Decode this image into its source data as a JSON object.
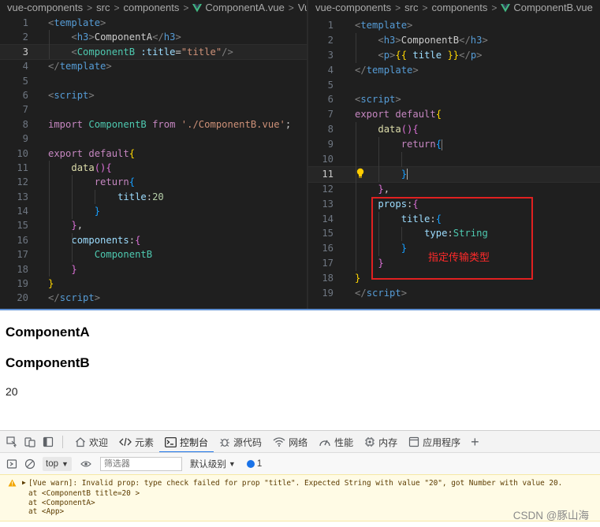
{
  "left_editor": {
    "breadcrumb": [
      "vue-components",
      "src",
      "components",
      "ComponentA.vue",
      "Vue"
    ],
    "current_line": 3,
    "lines": [
      {
        "n": "1",
        "tokens": [
          [
            "t-brk",
            "<"
          ],
          [
            "t-tag",
            "template"
          ],
          [
            "t-brk",
            ">"
          ]
        ]
      },
      {
        "n": "2",
        "tokens": [
          [
            "t-txt",
            "    "
          ],
          [
            "t-brk",
            "<"
          ],
          [
            "t-tag",
            "h3"
          ],
          [
            "t-brk",
            ">"
          ],
          [
            "t-txt",
            "ComponentA"
          ],
          [
            "t-brk",
            "</"
          ],
          [
            "t-tag",
            "h3"
          ],
          [
            "t-brk",
            ">"
          ]
        ]
      },
      {
        "n": "3",
        "tokens": [
          [
            "t-txt",
            "    "
          ],
          [
            "t-brk",
            "<"
          ],
          [
            "t-comp",
            "ComponentB"
          ],
          [
            "t-txt",
            " "
          ],
          [
            "t-attr",
            ":title"
          ],
          [
            "t-txt",
            "="
          ],
          [
            "t-str",
            "\"title\""
          ],
          [
            "t-brk",
            "/>"
          ]
        ]
      },
      {
        "n": "4",
        "tokens": [
          [
            "t-brk",
            "</"
          ],
          [
            "t-tag",
            "template"
          ],
          [
            "t-brk",
            ">"
          ]
        ]
      },
      {
        "n": "5",
        "tokens": []
      },
      {
        "n": "6",
        "tokens": [
          [
            "t-brk",
            "<"
          ],
          [
            "t-tag",
            "script"
          ],
          [
            "t-brk",
            ">"
          ]
        ]
      },
      {
        "n": "7",
        "tokens": []
      },
      {
        "n": "8",
        "tokens": [
          [
            "t-kw",
            "import"
          ],
          [
            "t-txt",
            " "
          ],
          [
            "t-comp",
            "ComponentB"
          ],
          [
            "t-txt",
            " "
          ],
          [
            "t-kw",
            "from"
          ],
          [
            "t-txt",
            " "
          ],
          [
            "t-str",
            "'./ComponentB.vue'"
          ],
          [
            "t-txt",
            ";"
          ]
        ]
      },
      {
        "n": "9",
        "tokens": []
      },
      {
        "n": "10",
        "tokens": [
          [
            "t-kw",
            "export"
          ],
          [
            "t-txt",
            " "
          ],
          [
            "t-kw",
            "default"
          ],
          [
            "b-y",
            "{"
          ]
        ]
      },
      {
        "n": "11",
        "tokens": [
          [
            "t-txt",
            "    "
          ],
          [
            "t-fn",
            "data"
          ],
          [
            "b-p",
            "()"
          ],
          [
            "b-p",
            "{"
          ]
        ]
      },
      {
        "n": "12",
        "tokens": [
          [
            "t-txt",
            "        "
          ],
          [
            "t-kw",
            "return"
          ],
          [
            "b-b",
            "{"
          ]
        ]
      },
      {
        "n": "13",
        "tokens": [
          [
            "t-txt",
            "            "
          ],
          [
            "t-var",
            "title"
          ],
          [
            "t-txt",
            ":"
          ],
          [
            "t-num",
            "20"
          ]
        ]
      },
      {
        "n": "14",
        "tokens": [
          [
            "t-txt",
            "        "
          ],
          [
            "b-b",
            "}"
          ]
        ]
      },
      {
        "n": "15",
        "tokens": [
          [
            "t-txt",
            "    "
          ],
          [
            "b-p",
            "}"
          ],
          [
            "t-txt",
            ","
          ]
        ]
      },
      {
        "n": "16",
        "tokens": [
          [
            "t-txt",
            "    "
          ],
          [
            "t-var",
            "components"
          ],
          [
            "t-txt",
            ":"
          ],
          [
            "b-p",
            "{"
          ]
        ]
      },
      {
        "n": "17",
        "tokens": [
          [
            "t-txt",
            "        "
          ],
          [
            "t-comp",
            "ComponentB"
          ]
        ]
      },
      {
        "n": "18",
        "tokens": [
          [
            "t-txt",
            "    "
          ],
          [
            "b-p",
            "}"
          ]
        ]
      },
      {
        "n": "19",
        "tokens": [
          [
            "b-y",
            "}"
          ]
        ]
      },
      {
        "n": "20",
        "tokens": [
          [
            "t-brk",
            "</"
          ],
          [
            "t-tag",
            "script"
          ],
          [
            "t-brk",
            ">"
          ]
        ]
      }
    ]
  },
  "right_editor": {
    "breadcrumb": [
      "vue-components",
      "src",
      "components",
      "ComponentB.vue"
    ],
    "current_line": 11,
    "lines": [
      {
        "n": "1",
        "tokens": [
          [
            "t-brk",
            "<"
          ],
          [
            "t-tag",
            "template"
          ],
          [
            "t-brk",
            ">"
          ]
        ]
      },
      {
        "n": "2",
        "tokens": [
          [
            "t-txt",
            "    "
          ],
          [
            "t-brk",
            "<"
          ],
          [
            "t-tag",
            "h3"
          ],
          [
            "t-brk",
            ">"
          ],
          [
            "t-txt",
            "ComponentB"
          ],
          [
            "t-brk",
            "</"
          ],
          [
            "t-tag",
            "h3"
          ],
          [
            "t-brk",
            ">"
          ]
        ]
      },
      {
        "n": "3",
        "tokens": [
          [
            "t-txt",
            "    "
          ],
          [
            "t-brk",
            "<"
          ],
          [
            "t-tag",
            "p"
          ],
          [
            "t-brk",
            ">"
          ],
          [
            "b-y",
            "{{"
          ],
          [
            "t-txt",
            " "
          ],
          [
            "t-var",
            "title"
          ],
          [
            "t-txt",
            " "
          ],
          [
            "b-y",
            "}}"
          ],
          [
            "t-brk",
            "</"
          ],
          [
            "t-tag",
            "p"
          ],
          [
            "t-brk",
            ">"
          ]
        ]
      },
      {
        "n": "4",
        "tokens": [
          [
            "t-brk",
            "</"
          ],
          [
            "t-tag",
            "template"
          ],
          [
            "t-brk",
            ">"
          ]
        ]
      },
      {
        "n": "5",
        "tokens": []
      },
      {
        "n": "6",
        "tokens": [
          [
            "t-brk",
            "<"
          ],
          [
            "t-tag",
            "script"
          ],
          [
            "t-brk",
            ">"
          ]
        ]
      },
      {
        "n": "7",
        "tokens": [
          [
            "t-kw",
            "export"
          ],
          [
            "t-txt",
            " "
          ],
          [
            "t-kw",
            "default"
          ],
          [
            "b-y",
            "{"
          ]
        ]
      },
      {
        "n": "8",
        "tokens": [
          [
            "t-txt",
            "    "
          ],
          [
            "t-fn",
            "data"
          ],
          [
            "b-p",
            "()"
          ],
          [
            "b-p",
            "{"
          ]
        ]
      },
      {
        "n": "9",
        "tokens": [
          [
            "t-txt",
            "        "
          ],
          [
            "t-kw",
            "return"
          ],
          [
            "b-b",
            "{"
          ]
        ]
      },
      {
        "n": "10",
        "tokens": []
      },
      {
        "n": "11",
        "tokens": [
          [
            "t-txt",
            "        "
          ],
          [
            "b-b",
            "}"
          ]
        ]
      },
      {
        "n": "12",
        "tokens": [
          [
            "t-txt",
            "    "
          ],
          [
            "b-p",
            "}"
          ],
          [
            "t-txt",
            ","
          ]
        ]
      },
      {
        "n": "13",
        "tokens": [
          [
            "t-txt",
            "    "
          ],
          [
            "t-var",
            "props"
          ],
          [
            "t-txt",
            ":"
          ],
          [
            "b-p",
            "{"
          ]
        ]
      },
      {
        "n": "14",
        "tokens": [
          [
            "t-txt",
            "        "
          ],
          [
            "t-var",
            "title"
          ],
          [
            "t-txt",
            ":"
          ],
          [
            "b-b",
            "{"
          ]
        ]
      },
      {
        "n": "15",
        "tokens": [
          [
            "t-txt",
            "            "
          ],
          [
            "t-var",
            "type"
          ],
          [
            "t-txt",
            ":"
          ],
          [
            "t-comp",
            "String"
          ]
        ]
      },
      {
        "n": "16",
        "tokens": [
          [
            "t-txt",
            "        "
          ],
          [
            "b-b",
            "}"
          ]
        ]
      },
      {
        "n": "17",
        "tokens": [
          [
            "t-txt",
            "    "
          ],
          [
            "b-p",
            "}"
          ]
        ]
      },
      {
        "n": "18",
        "tokens": [
          [
            "b-y",
            "}"
          ]
        ]
      },
      {
        "n": "19",
        "tokens": [
          [
            "t-brk",
            "</"
          ],
          [
            "t-tag",
            "script"
          ],
          [
            "t-brk",
            ">"
          ]
        ]
      }
    ],
    "annotation": "指定传输类型"
  },
  "render": {
    "h3_a": "ComponentA",
    "h3_b": "ComponentB",
    "p": "20"
  },
  "devtools": {
    "tabs": [
      {
        "name": "welcome",
        "label": "欢迎",
        "icon": "home-icon"
      },
      {
        "name": "elements",
        "label": "元素",
        "icon": "code-brackets-icon"
      },
      {
        "name": "console",
        "label": "控制台",
        "icon": "console-icon",
        "active": true
      },
      {
        "name": "sources",
        "label": "源代码",
        "icon": "bug-icon"
      },
      {
        "name": "network",
        "label": "网络",
        "icon": "wifi-icon"
      },
      {
        "name": "performance",
        "label": "性能",
        "icon": "gauge-icon"
      },
      {
        "name": "memory",
        "label": "内存",
        "icon": "chip-icon"
      },
      {
        "name": "application",
        "label": "应用程序",
        "icon": "app-window-icon"
      }
    ],
    "context": "top",
    "filter_placeholder": "筛选器",
    "levels": "默认级别",
    "issue_count": "1",
    "warning": {
      "message": "[Vue warn]: Invalid prop: type check failed for prop \"title\". Expected String with value \"20\", got Number with value 20.",
      "trace": [
        "at <ComponentB title=20 >",
        "at <ComponentA>",
        "at <App>"
      ]
    }
  },
  "watermark": "CSDN @豚山海"
}
